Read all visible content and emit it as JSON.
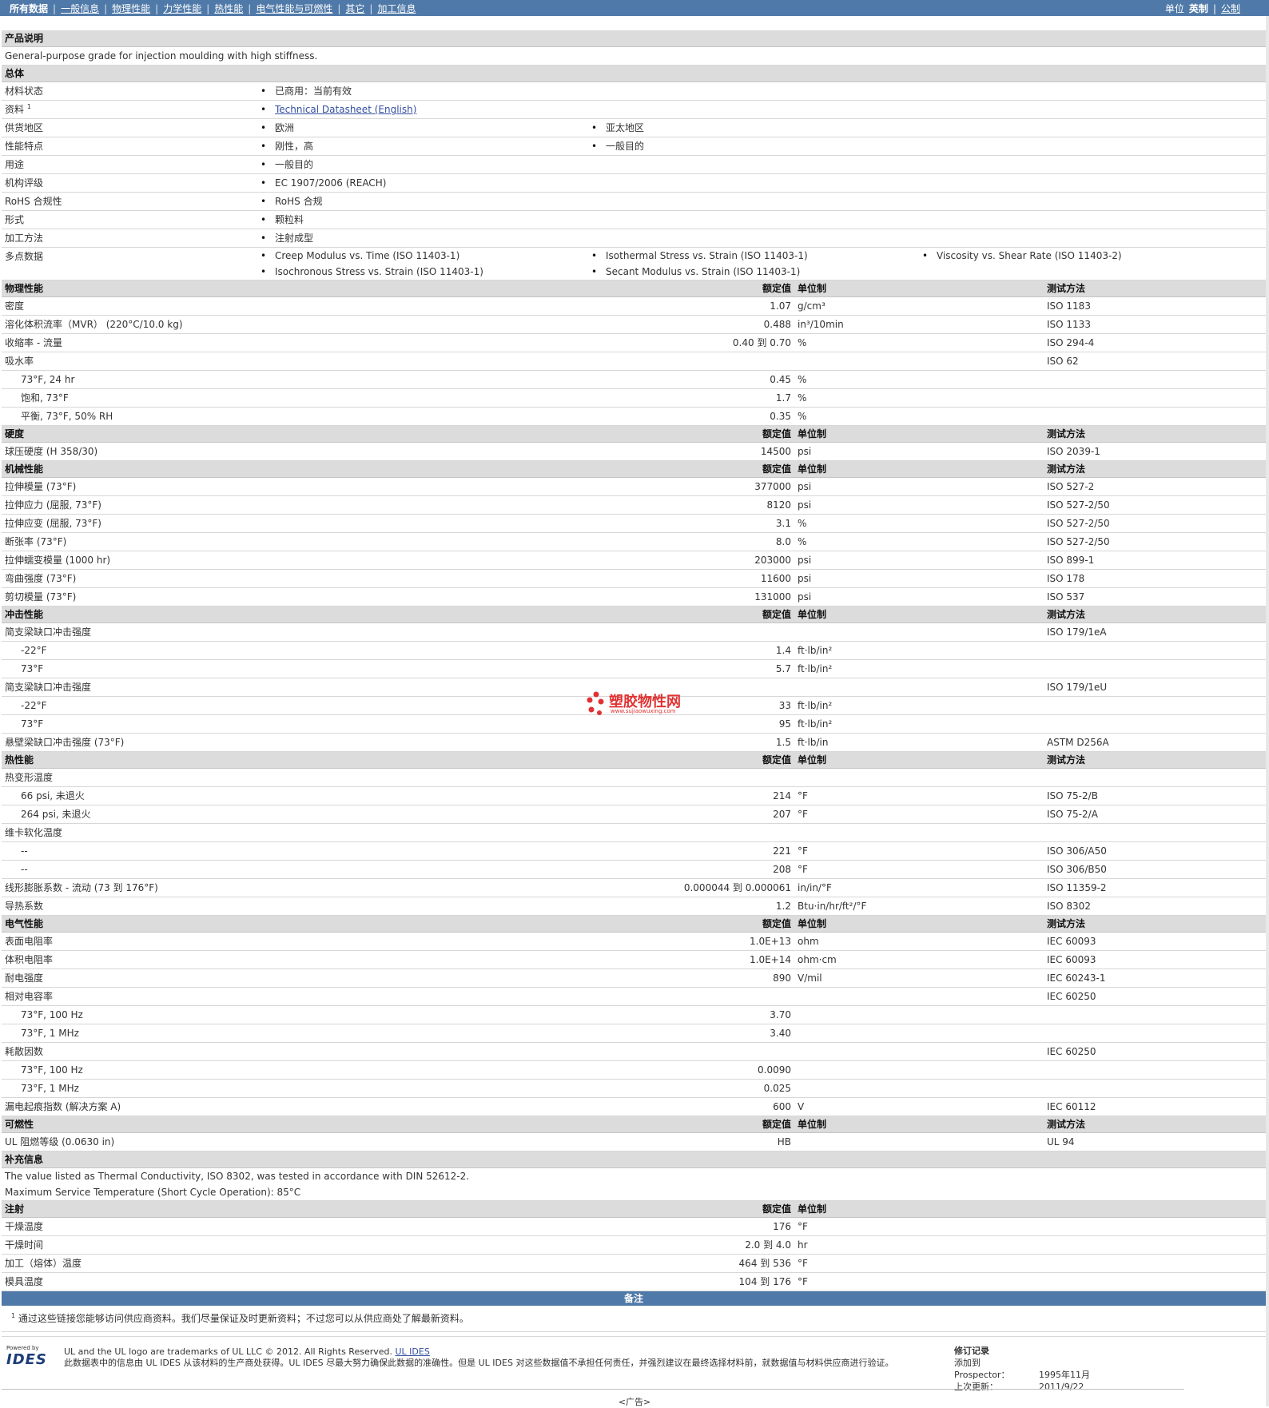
{
  "topnav": {
    "items": [
      "所有数据",
      "一般信息",
      "物理性能",
      "力学性能",
      "热性能",
      "电气性能与可燃性",
      "其它",
      "加工信息"
    ],
    "units_label": "单位",
    "units_active": "英制",
    "units_other": "公制"
  },
  "product_desc": {
    "title": "产品说明",
    "text": "General-purpose grade for injection moulding with high stiffness."
  },
  "general": {
    "title": "总体",
    "rows": [
      {
        "name": "材料状态",
        "values": [
          "已商用：当前有效"
        ]
      },
      {
        "name": "资料",
        "sup": "1",
        "link": "Technical Datasheet (English)"
      },
      {
        "name": "供货地区",
        "values": [
          "欧洲",
          "亚太地区"
        ]
      },
      {
        "name": "性能特点",
        "values": [
          "刚性，高",
          "一般目的"
        ]
      },
      {
        "name": "用途",
        "values": [
          "一般目的"
        ]
      },
      {
        "name": "机构评级",
        "values": [
          "EC 1907/2006 (REACH)"
        ]
      },
      {
        "name": "RoHS 合规性",
        "values": [
          "RoHS 合规"
        ]
      },
      {
        "name": "形式",
        "values": [
          "颗粒料"
        ]
      },
      {
        "name": "加工方法",
        "values": [
          "注射成型"
        ]
      },
      {
        "name": "多点数据",
        "values": [
          "Creep Modulus vs. Time (ISO 11403-1)",
          "Isothermal Stress vs. Strain (ISO 11403-1)",
          "Viscosity vs. Shear Rate (ISO 11403-2)",
          "Isochronous Stress vs. Strain (ISO 11403-1)",
          "Secant Modulus vs. Strain (ISO 11403-1)"
        ]
      }
    ]
  },
  "headers": {
    "value": "额定值",
    "unit": "单位制",
    "method": "测试方法"
  },
  "sections": [
    {
      "title": "物理性能",
      "rows": [
        {
          "name": "密度",
          "value": "1.07",
          "unit": "g/cm³",
          "method": "ISO 1183"
        },
        {
          "name": "溶化体积流率（MVR） (220°C/10.0 kg)",
          "value": "0.488",
          "unit": "in³/10min",
          "method": "ISO 1133"
        },
        {
          "name": "收缩率 - 流量",
          "value": "0.40 到 0.70",
          "unit": "%",
          "method": "ISO 294-4"
        },
        {
          "name": "吸水率",
          "value": "",
          "unit": "",
          "method": "ISO 62"
        },
        {
          "name": "73°F, 24 hr",
          "value": "0.45",
          "unit": "%",
          "method": "",
          "indent": true
        },
        {
          "name": "饱和, 73°F",
          "value": "1.7",
          "unit": "%",
          "method": "",
          "indent": true
        },
        {
          "name": "平衡, 73°F, 50% RH",
          "value": "0.35",
          "unit": "%",
          "method": "",
          "indent": true
        }
      ]
    },
    {
      "title": "硬度",
      "rows": [
        {
          "name": "球压硬度 (H 358/30)",
          "value": "14500",
          "unit": "psi",
          "method": "ISO 2039-1"
        }
      ]
    },
    {
      "title": "机械性能",
      "rows": [
        {
          "name": "拉伸模量 (73°F)",
          "value": "377000",
          "unit": "psi",
          "method": "ISO 527-2"
        },
        {
          "name": "拉伸应力 (屈服, 73°F)",
          "value": "8120",
          "unit": "psi",
          "method": "ISO 527-2/50"
        },
        {
          "name": "拉伸应变 (屈服, 73°F)",
          "value": "3.1",
          "unit": "%",
          "method": "ISO 527-2/50"
        },
        {
          "name": "断张率 (73°F)",
          "value": "8.0",
          "unit": "%",
          "method": "ISO 527-2/50"
        },
        {
          "name": "拉伸蠕变模量 (1000 hr)",
          "value": "203000",
          "unit": "psi",
          "method": "ISO 899-1"
        },
        {
          "name": "弯曲强度 (73°F)",
          "value": "11600",
          "unit": "psi",
          "method": "ISO 178"
        },
        {
          "name": "剪切模量 (73°F)",
          "value": "131000",
          "unit": "psi",
          "method": "ISO 537"
        }
      ]
    },
    {
      "title": "冲击性能",
      "rows": [
        {
          "name": "简支梁缺口冲击强度",
          "value": "",
          "unit": "",
          "method": "ISO 179/1eA"
        },
        {
          "name": "-22°F",
          "value": "1.4",
          "unit": "ft·lb/in²",
          "method": "",
          "indent": true
        },
        {
          "name": "73°F",
          "value": "5.7",
          "unit": "ft·lb/in²",
          "method": "",
          "indent": true
        },
        {
          "name": "简支梁缺口冲击强度",
          "value": "",
          "unit": "",
          "method": "ISO 179/1eU"
        },
        {
          "name": "-22°F",
          "value": "33",
          "unit": "ft·lb/in²",
          "method": "",
          "indent": true
        },
        {
          "name": "73°F",
          "value": "95",
          "unit": "ft·lb/in²",
          "method": "",
          "indent": true
        },
        {
          "name": "悬壁梁缺口冲击强度 (73°F)",
          "value": "1.5",
          "unit": "ft·lb/in",
          "method": "ASTM D256A"
        }
      ]
    },
    {
      "title": "热性能",
      "rows": [
        {
          "name": "热变形温度",
          "value": "",
          "unit": "",
          "method": ""
        },
        {
          "name": "66 psi, 未退火",
          "value": "214",
          "unit": "°F",
          "method": "ISO 75-2/B",
          "indent": true
        },
        {
          "name": "264 psi, 未退火",
          "value": "207",
          "unit": "°F",
          "method": "ISO 75-2/A",
          "indent": true
        },
        {
          "name": "维卡软化温度",
          "value": "",
          "unit": "",
          "method": ""
        },
        {
          "name": "--",
          "value": "221",
          "unit": "°F",
          "method": "ISO 306/A50",
          "indent": true
        },
        {
          "name": "--",
          "value": "208",
          "unit": "°F",
          "method": "ISO 306/B50",
          "indent": true
        },
        {
          "name": "线形膨胀系数 - 流动 (73 到 176°F)",
          "value": "0.000044 到 0.000061",
          "unit": "in/in/°F",
          "method": "ISO 11359-2"
        },
        {
          "name": "导热系数",
          "value": "1.2",
          "unit": "Btu·in/hr/ft²/°F",
          "method": "ISO 8302"
        }
      ]
    },
    {
      "title": "电气性能",
      "rows": [
        {
          "name": "表面电阻率",
          "value": "1.0E+13",
          "unit": "ohm",
          "method": "IEC 60093"
        },
        {
          "name": "体积电阻率",
          "value": "1.0E+14",
          "unit": "ohm·cm",
          "method": "IEC 60093"
        },
        {
          "name": "耐电强度",
          "value": "890",
          "unit": "V/mil",
          "method": "IEC 60243-1"
        },
        {
          "name": "相对电容率",
          "value": "",
          "unit": "",
          "method": "IEC 60250"
        },
        {
          "name": "73°F, 100 Hz",
          "value": "3.70",
          "unit": "",
          "method": "",
          "indent": true
        },
        {
          "name": "73°F, 1 MHz",
          "value": "3.40",
          "unit": "",
          "method": "",
          "indent": true
        },
        {
          "name": "耗散因数",
          "value": "",
          "unit": "",
          "method": "IEC 60250"
        },
        {
          "name": "73°F, 100 Hz",
          "value": "0.0090",
          "unit": "",
          "method": "",
          "indent": true
        },
        {
          "name": "73°F, 1 MHz",
          "value": "0.025",
          "unit": "",
          "method": "",
          "indent": true
        },
        {
          "name": "漏电起痕指数 (解决方案 A)",
          "value": "600",
          "unit": "V",
          "method": "IEC 60112"
        }
      ]
    },
    {
      "title": "可燃性",
      "rows": [
        {
          "name": "UL 阻燃等级 (0.0630 in)",
          "value": "HB",
          "unit": "",
          "method": "UL 94"
        }
      ]
    }
  ],
  "supplement": {
    "title": "补充信息",
    "lines": [
      "The value listed as Thermal Conductivity, ISO 8302, was tested in accordance with DIN 52612-2.",
      "Maximum Service Temperature (Short Cycle Operation): 85°C"
    ]
  },
  "injection": {
    "title": "注射",
    "rows": [
      {
        "name": "干燥温度",
        "value": "176",
        "unit": "°F"
      },
      {
        "name": "干燥时间",
        "value": "2.0 到 4.0",
        "unit": "hr"
      },
      {
        "name": "加工（熔体）温度",
        "value": "464 到 536",
        "unit": "°F"
      },
      {
        "name": "模具温度",
        "value": "104 到 176",
        "unit": "°F"
      }
    ]
  },
  "remarks": {
    "title": "备注",
    "footnote_sup": "1",
    "footnote": "通过这些链接您能够访问供应商资料。我们尽量保证及时更新资料；不过您可以从供应商处了解最新资料。"
  },
  "watermark": {
    "cn": "塑胶物性网",
    "url": "www.sujiaowuxing.com"
  },
  "footer": {
    "powered": "Powered by",
    "logo": "IDES",
    "line1": "UL and the UL logo are trademarks of UL LLC © 2012. All Rights Reserved.",
    "line1_link": "UL IDES",
    "line2": "此数据表中的信息由 UL IDES 从该材料的生产商处获得。UL IDES 尽最大努力确保此数据的准确性。但是 UL IDES 对这些数据值不承担任何责任，并强烈建议在最终选择材料前，就数据值与材料供应商进行验证。",
    "rev_title": "修订记录",
    "added_label": "添加到 Prospector：",
    "added_value": "1995年11月",
    "updated_label": "上次更新：",
    "updated_value": "2011/9/22"
  },
  "ad": "<广告>"
}
